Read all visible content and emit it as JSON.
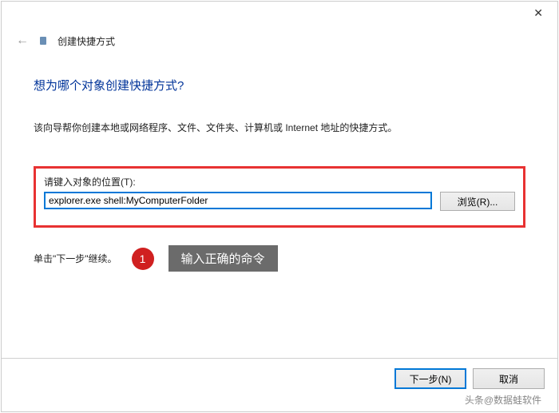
{
  "window": {
    "title": "创建快捷方式"
  },
  "main": {
    "heading": "想为哪个对象创建快捷方式?",
    "description": "该向导帮你创建本地或网络程序、文件、文件夹、计算机或 Internet 地址的快捷方式。",
    "field_label": "请键入对象的位置(T):",
    "location_value": "explorer.exe shell:MyComputerFolder",
    "browse_label": "浏览(R)...",
    "continue_text": "单击\"下一步\"继续。"
  },
  "callout": {
    "number": "1",
    "text": "输入正确的命令"
  },
  "footer": {
    "next_label": "下一步(N)",
    "cancel_label": "取消"
  },
  "watermark": "头条@数据蛙软件"
}
